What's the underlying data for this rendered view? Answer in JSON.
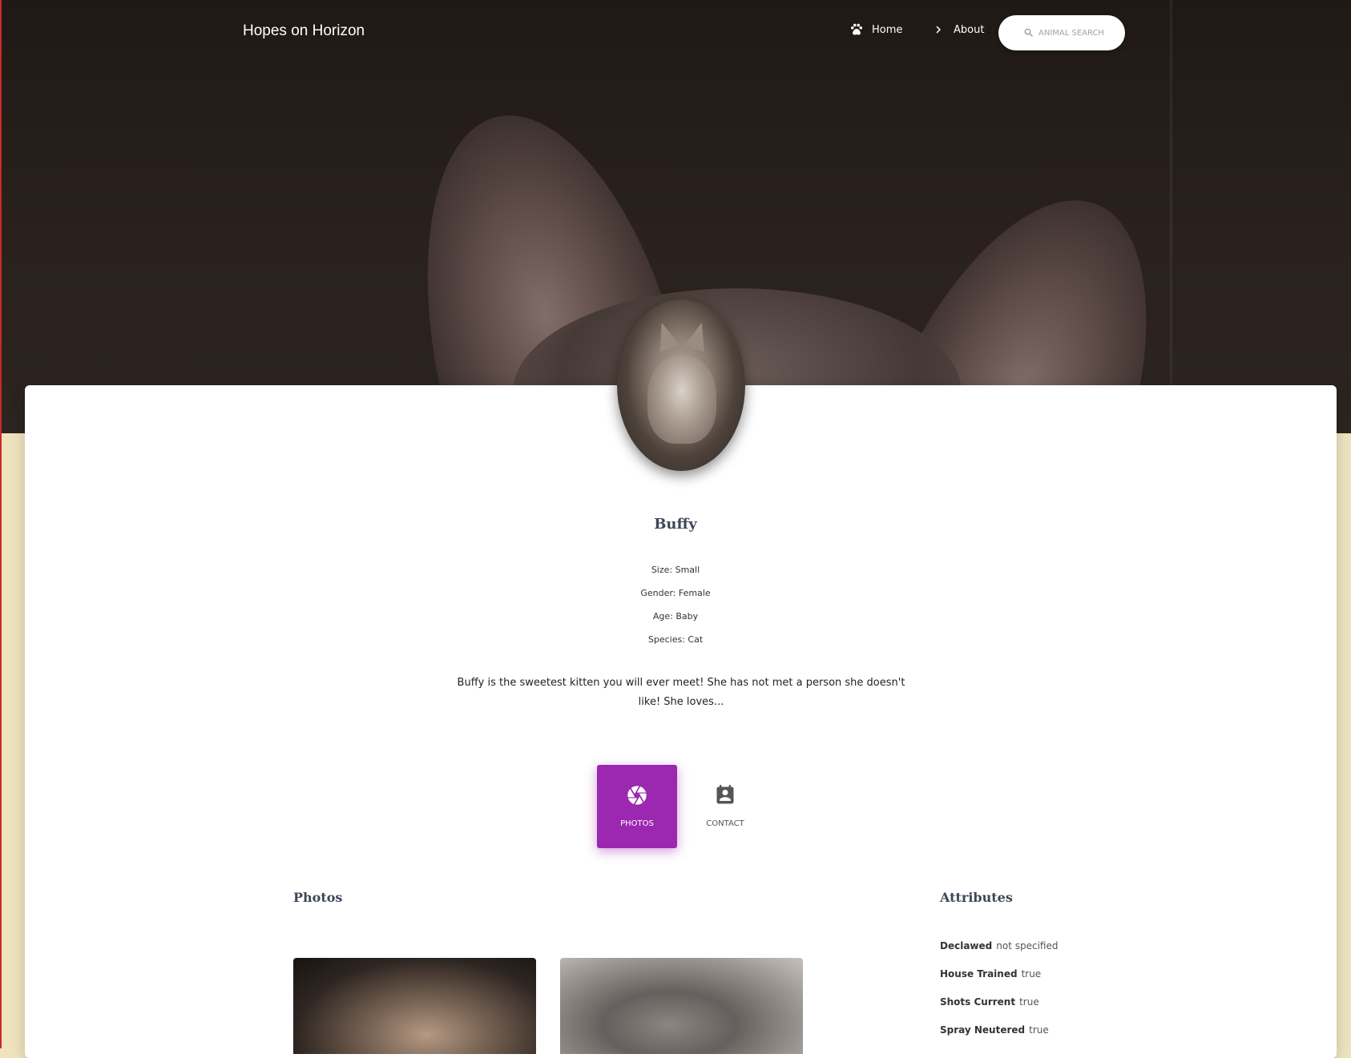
{
  "header": {
    "brand": "Hopes on Horizon",
    "nav": [
      {
        "label": "Home",
        "icon": "paw-icon"
      },
      {
        "label": "About",
        "icon": "chevron-right-icon"
      }
    ],
    "search": {
      "placeholder": "ANIMAL SEARCH",
      "icon": "search-icon"
    }
  },
  "pet": {
    "name": "Buffy",
    "facts": [
      {
        "text": "Size: Small"
      },
      {
        "text": "Gender: Female"
      },
      {
        "text": "Age: Baby"
      },
      {
        "text": "Species: Cat"
      }
    ],
    "description_line1": "Buffy is the sweetest kitten you will ever meet! She has not met a person she doesn't",
    "description_line2": "like! She loves...",
    "avatar_alt": "kitten-photo"
  },
  "tabs": [
    {
      "label": "PHOTOS",
      "icon": "camera-aperture-icon",
      "active": true
    },
    {
      "label": "CONTACT",
      "icon": "contact-card-icon",
      "active": false
    }
  ],
  "photos_section": {
    "title": "Photos"
  },
  "attributes_section": {
    "title": "Attributes",
    "items": [
      {
        "key": "Declawed",
        "value": "not specified"
      },
      {
        "key": "House Trained",
        "value": "true"
      },
      {
        "key": "Shots Current",
        "value": "true"
      },
      {
        "key": "Spray Neutered",
        "value": "true"
      }
    ]
  },
  "colors": {
    "accent": "#9c27b0",
    "page_background": "#efe3bf",
    "heading": "#3c4858"
  }
}
